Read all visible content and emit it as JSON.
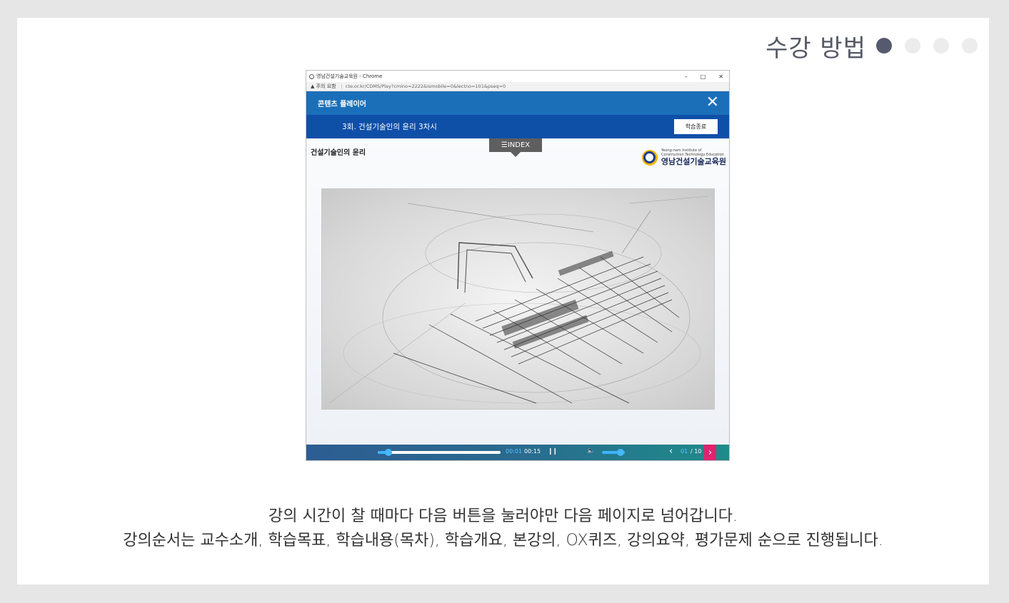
{
  "header": {
    "title": "수강 방법",
    "steps": [
      {
        "active": true
      },
      {
        "active": false
      },
      {
        "active": false
      },
      {
        "active": false
      }
    ]
  },
  "screenshot": {
    "window_title": "영남건설기술교육원 - Chrome",
    "window_controls": [
      "–",
      "□",
      "✕"
    ],
    "address": {
      "warning": "▲ 주의 요함",
      "separator": "|",
      "url": "cte.or.kr/CDMS/Play?cmino=2222&ismobile=0&lectno=101&pseq=0"
    },
    "player_title": "콘텐츠 플레이어",
    "lesson_title": "3회. 건설기술인의 윤리 3차시",
    "end_button": "학습종료",
    "index_tab": "☰INDEX",
    "section_title": "건설기술인의 윤리",
    "logo": {
      "en_line1": "Yeong-nam Institute of",
      "en_line2": "Construction Technology Education",
      "ko": "영남건설기술교육원"
    },
    "controls": {
      "progress": 0.07,
      "time_current": "00:01",
      "time_total": "00:15",
      "volume": 0.85,
      "page_current": "01",
      "page_total": "/ 10"
    }
  },
  "description": {
    "line1": "강의 시간이 찰 때마다 다음 버튼을 눌러야만 다음 페이지로 넘어갑니다.",
    "line2": "강의순서는 교수소개, 학습목표, 학습내용(목차), 학습개요, 본강의, OX퀴즈, 강의요약, 평가문제 순으로 진행됩니다."
  },
  "colors": {
    "accent_blue": "#1b6fb9",
    "lesson_blue": "#0e4fa8",
    "next_pink": "#e0236f",
    "dot_active": "#565a6e"
  }
}
